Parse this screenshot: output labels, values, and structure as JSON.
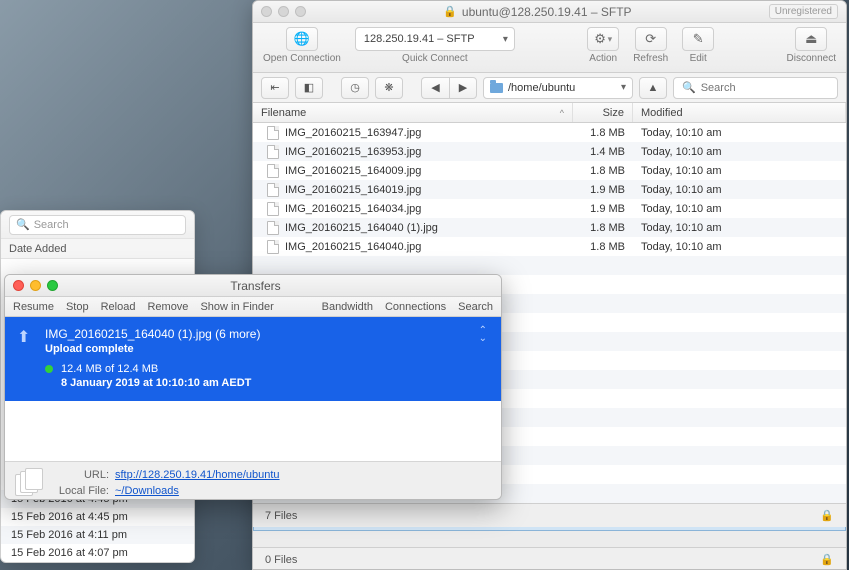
{
  "main_window": {
    "title": "ubuntu@128.250.19.41 – SFTP",
    "unregistered": "Unregistered",
    "toolbar": {
      "open_connection": "Open Connection",
      "quick_connect_value": "128.250.19.41 – SFTP",
      "quick_connect": "Quick Connect",
      "action": "Action",
      "refresh": "Refresh",
      "edit": "Edit",
      "disconnect": "Disconnect"
    },
    "nav": {
      "path": "/home/ubuntu",
      "up": "▲",
      "search_placeholder": "Search"
    },
    "columns": {
      "filename": "Filename",
      "size": "Size",
      "modified": "Modified"
    },
    "files": [
      {
        "name": "IMG_20160215_163947.jpg",
        "size": "1.8 MB",
        "modified": "Today, 10:10 am"
      },
      {
        "name": "IMG_20160215_163953.jpg",
        "size": "1.4 MB",
        "modified": "Today, 10:10 am"
      },
      {
        "name": "IMG_20160215_164009.jpg",
        "size": "1.8 MB",
        "modified": "Today, 10:10 am"
      },
      {
        "name": "IMG_20160215_164019.jpg",
        "size": "1.9 MB",
        "modified": "Today, 10:10 am"
      },
      {
        "name": "IMG_20160215_164034.jpg",
        "size": "1.9 MB",
        "modified": "Today, 10:10 am"
      },
      {
        "name": "IMG_20160215_164040 (1).jpg",
        "size": "1.8 MB",
        "modified": "Today, 10:10 am"
      },
      {
        "name": "IMG_20160215_164040.jpg",
        "size": "1.8 MB",
        "modified": "Today, 10:10 am"
      }
    ],
    "status_upper": "7 Files",
    "status_lower": "0 Files"
  },
  "finder": {
    "search_placeholder": "Search",
    "header": "Date Added",
    "rows": [
      "15 Feb 2016 at 4:45 pm",
      "15 Feb 2016 at 4:45 pm",
      "15 Feb 2016 at 4:11 pm",
      "15 Feb 2016 at 4:07 pm"
    ]
  },
  "transfers": {
    "title": "Transfers",
    "menu": {
      "resume": "Resume",
      "stop": "Stop",
      "reload": "Reload",
      "remove": "Remove",
      "show_in_finder": "Show in Finder",
      "bandwidth": "Bandwidth",
      "connections": "Connections",
      "search": "Search"
    },
    "item": {
      "name": "IMG_20160215_164040 (1).jpg (6 more)",
      "status": "Upload complete",
      "progress": "12.4 MB of 12.4 MB",
      "timestamp": "8 January 2019 at 10:10:10 am AEDT"
    },
    "footer": {
      "url_label": "URL:",
      "url": "sftp://128.250.19.41/home/ubuntu",
      "local_label": "Local File:",
      "local": "~/Downloads"
    }
  }
}
